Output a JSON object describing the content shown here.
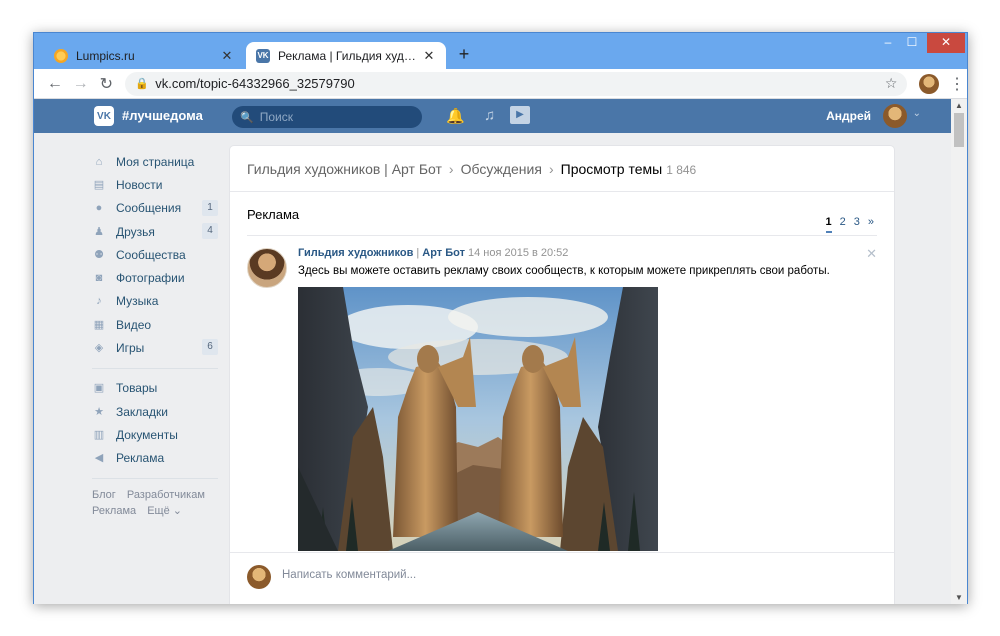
{
  "browser": {
    "tabs": [
      {
        "title": "Lumpics.ru",
        "active": false
      },
      {
        "title": "Реклама | Гильдия художников",
        "active": true
      }
    ],
    "new_tab": "+",
    "url": "vk.com/topic-64332966_32579790",
    "controls": {
      "min": "–",
      "max": "☐",
      "close": "✕"
    }
  },
  "vk": {
    "logo": "VK",
    "hashtag": "#лучшедома",
    "search_placeholder": "Поиск",
    "user_name": "Андрей",
    "menu": [
      {
        "label": "Моя страница",
        "icon": "home-icon",
        "badge": ""
      },
      {
        "label": "Новости",
        "icon": "news-icon",
        "badge": ""
      },
      {
        "label": "Сообщения",
        "icon": "messages-icon",
        "badge": "1"
      },
      {
        "label": "Друзья",
        "icon": "friends-icon",
        "badge": "4"
      },
      {
        "label": "Сообщества",
        "icon": "communities-icon",
        "badge": ""
      },
      {
        "label": "Фотографии",
        "icon": "camera-icon",
        "badge": ""
      },
      {
        "label": "Музыка",
        "icon": "music-icon",
        "badge": ""
      },
      {
        "label": "Видео",
        "icon": "video-icon",
        "badge": ""
      },
      {
        "label": "Игры",
        "icon": "games-icon",
        "badge": "6"
      }
    ],
    "menu2": [
      {
        "label": "Товары",
        "icon": "goods-icon"
      },
      {
        "label": "Закладки",
        "icon": "star-icon"
      },
      {
        "label": "Документы",
        "icon": "document-icon"
      },
      {
        "label": "Реклама",
        "icon": "megaphone-icon"
      }
    ],
    "footer_links": [
      "Блог",
      "Разработчикам",
      "Реклама",
      "Ещё ⌄"
    ]
  },
  "topic": {
    "breadcrumb": [
      "Гильдия художников | Арт Бот",
      "Обсуждения",
      "Просмотр темы"
    ],
    "count": "1 846",
    "title": "Реклама",
    "pages": [
      "1",
      "2",
      "3",
      "»"
    ],
    "post": {
      "author": "Гильдия художников",
      "author2": "Арт Бот",
      "date": "14 ноя 2015 в 20:52",
      "text": "Здесь вы можете оставить рекламу своих сообществ, к которым можете прикреплять свои работы."
    },
    "comment_placeholder": "Написать комментарий..."
  }
}
